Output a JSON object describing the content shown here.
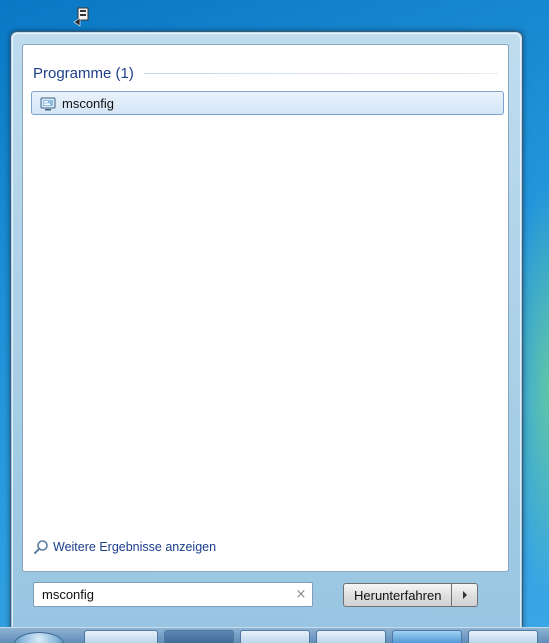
{
  "desktop": {
    "icon": "network-shortcut-icon"
  },
  "start_menu": {
    "results": {
      "group_title": "Programme (1)",
      "items": [
        {
          "label": "msconfig",
          "icon": "system-configuration-icon"
        }
      ],
      "more_results_label": "Weitere Ergebnisse anzeigen",
      "more_results_icon": "magnifier-icon"
    },
    "search": {
      "value": "msconfig",
      "clear_icon": "×"
    },
    "shutdown": {
      "label": "Herunterfahren",
      "arrow_icon": "triangle-right-icon"
    }
  },
  "colors": {
    "accent_text": "#1e3f8a",
    "selection_border": "#7da2ce",
    "link_text": "#1a3e8c"
  }
}
